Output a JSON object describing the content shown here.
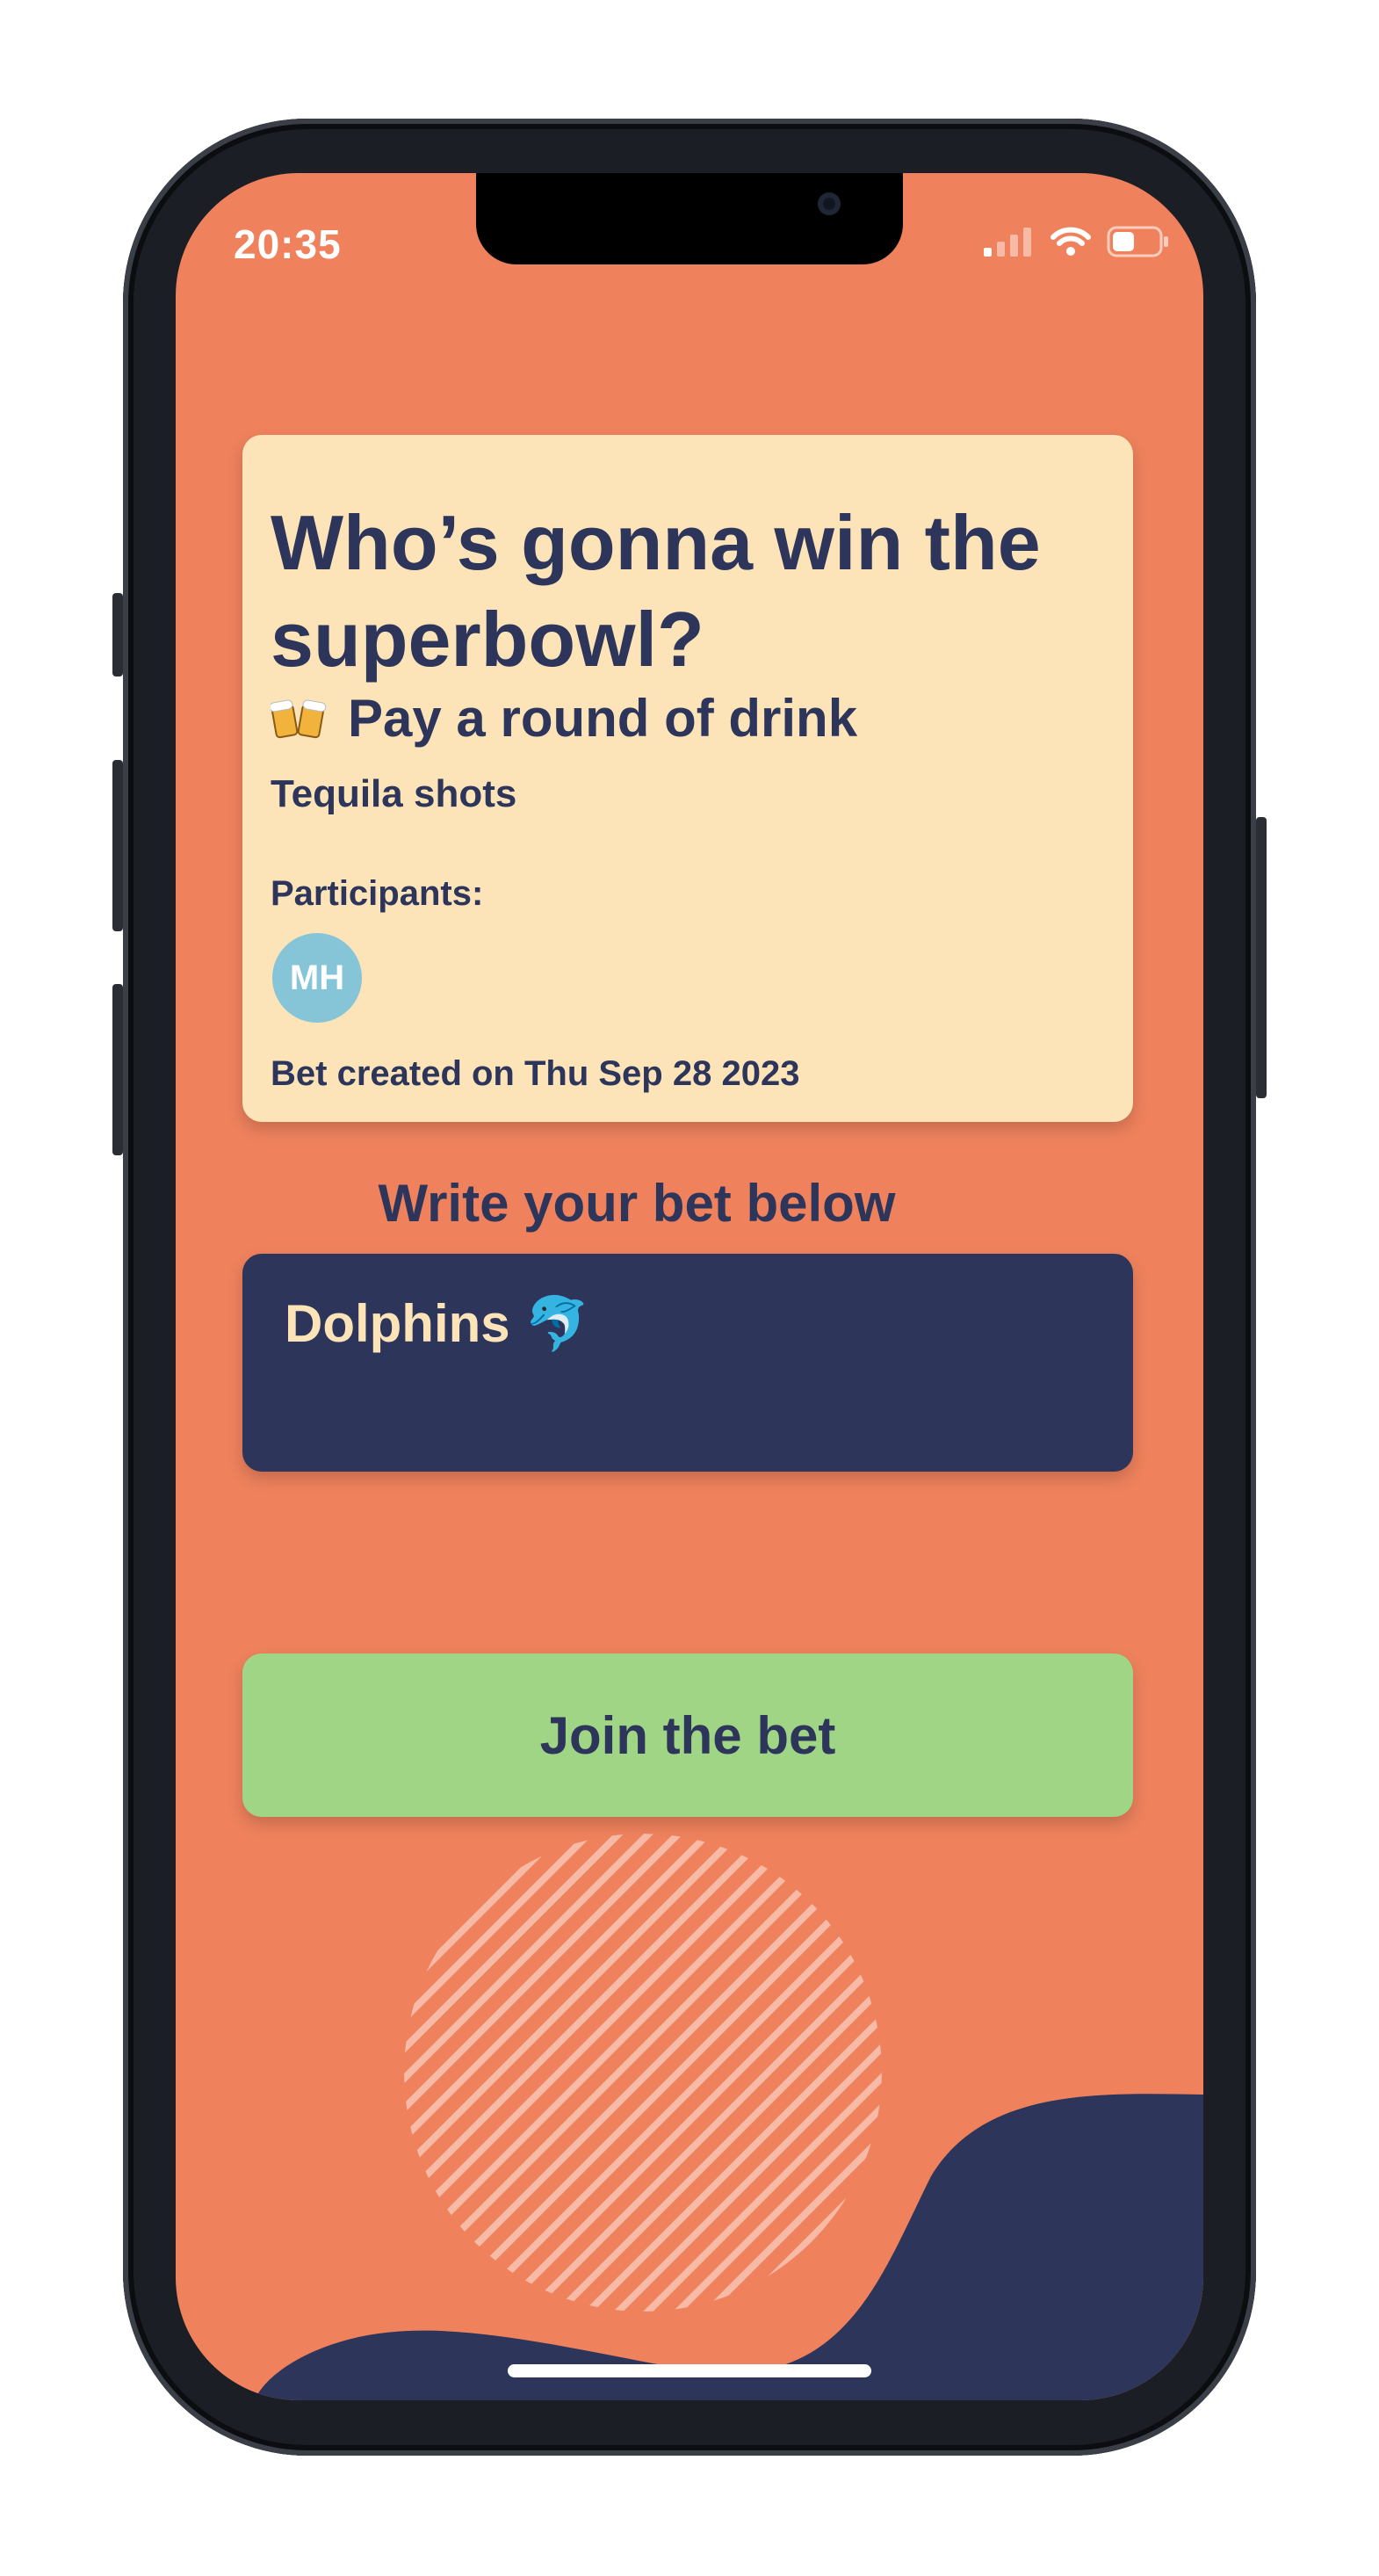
{
  "status_bar": {
    "time": "20:35"
  },
  "bet_card": {
    "title": "Who’s gonna win the superbowl?",
    "reward_icon": "beer-mugs-icon",
    "reward": "Pay a round of drink",
    "detail": "Tequila shots",
    "participants_label": "Participants:",
    "participants": [
      {
        "initials": "MH"
      }
    ],
    "created": "Bet created on Thu Sep 28 2023"
  },
  "bet_input": {
    "label": "Write your bet below",
    "value": "Dolphins 🐬"
  },
  "join_button": {
    "label": "Join the bet"
  },
  "colors": {
    "background": "#ef825d",
    "card": "#fce4b8",
    "navy": "#2d365a",
    "button": "#9fd584",
    "avatar": "#86c5d8"
  }
}
